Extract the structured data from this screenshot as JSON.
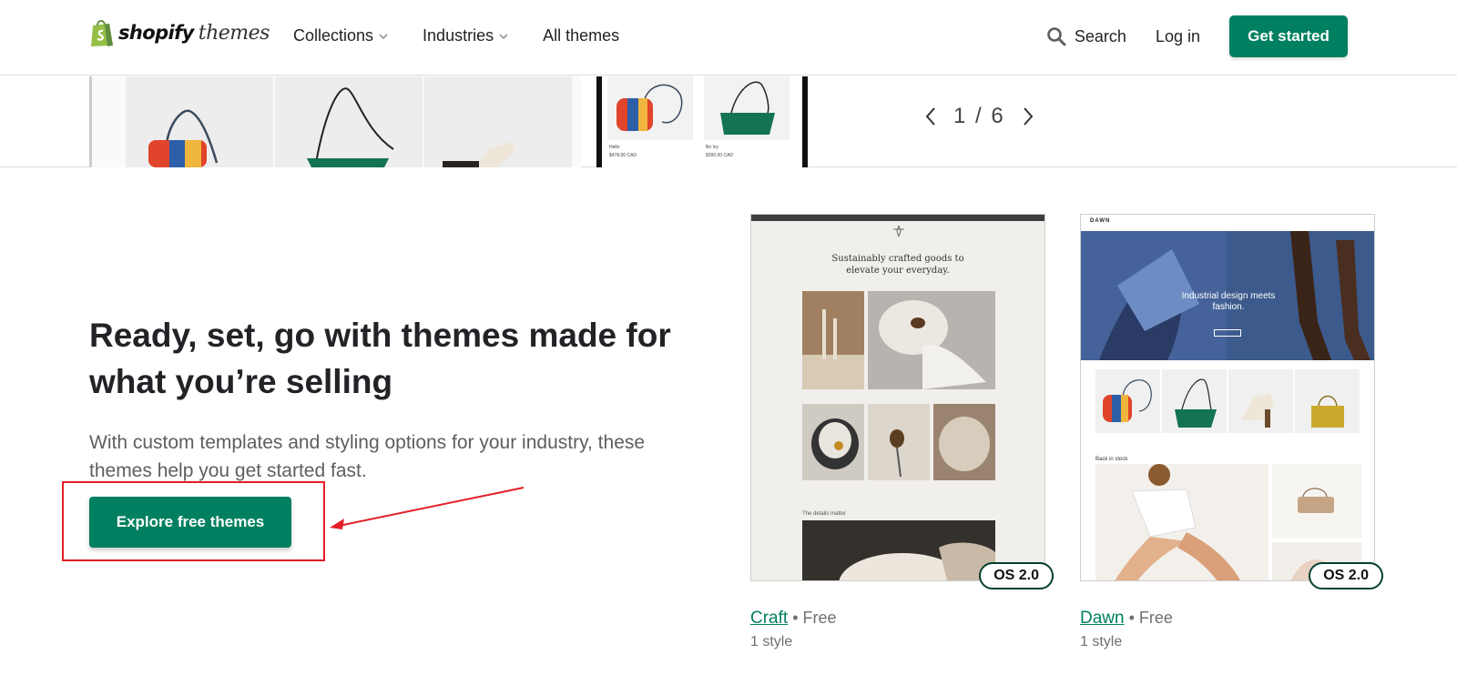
{
  "header": {
    "logo_brand": "shopify",
    "logo_suffix": "themes",
    "nav": [
      "Collections",
      "Industries",
      "All themes"
    ],
    "search_label": "Search",
    "login_label": "Log in",
    "cta_label": "Get started"
  },
  "carousel": {
    "page_indicator": "1 / 6",
    "phone_items": [
      {
        "name": "Hello",
        "price": "$478.00 CAD"
      },
      {
        "name": "Bo Ivy",
        "price": "$390.00 CAD"
      }
    ]
  },
  "hero": {
    "title": "Ready, set, go with themes made for what you’re selling",
    "subtitle": "With custom templates and styling options for your industry, these themes help you get started fast.",
    "button_label": "Explore free themes"
  },
  "themes": [
    {
      "name": "Craft",
      "price": "Free",
      "styles": "1 style",
      "badge": "OS 2.0",
      "preview_tagline": "Sustainably crafted goods to elevate your everyday.",
      "preview_section": "The details matter"
    },
    {
      "name": "Dawn",
      "price": "Free",
      "styles": "1 style",
      "badge": "OS 2.0",
      "preview_brand": "DAWN",
      "preview_hero": "Industrial design meets fashion.",
      "preview_section": "Back in stock"
    }
  ],
  "colors": {
    "brand_green": "#008060",
    "annotation_red": "#e41e26"
  },
  "icons": [
    "shopify-bag-icon",
    "chevron-down-icon",
    "search-icon",
    "chevron-left-icon",
    "chevron-right-icon",
    "annotation-arrow"
  ]
}
